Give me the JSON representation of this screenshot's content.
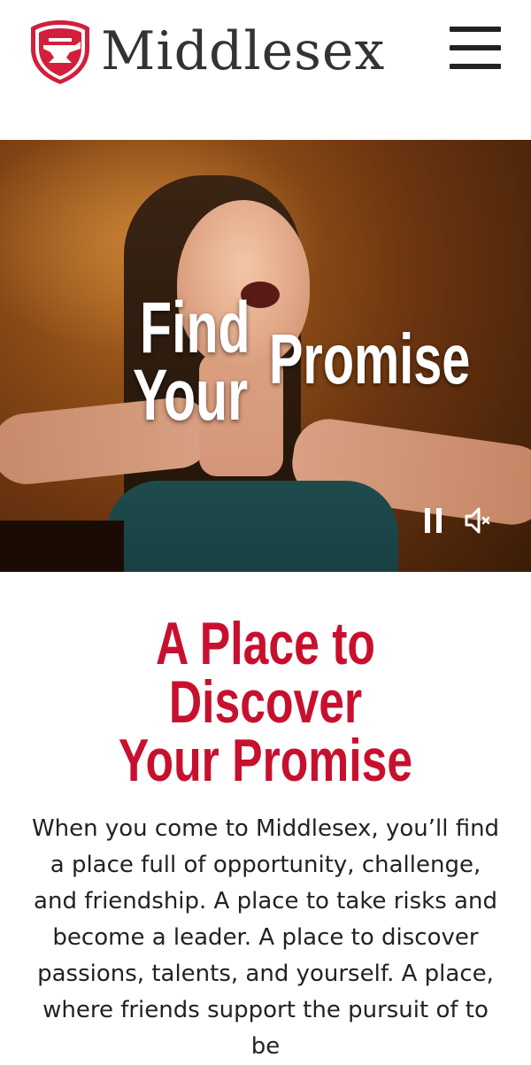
{
  "header": {
    "brand_name": "Middlesex",
    "logo_icon": "shield-anvil-icon",
    "menu_icon": "hamburger-menu-icon",
    "accent_color": "#c8102e"
  },
  "hero": {
    "title_line1": "Find",
    "title_line2": "Your",
    "title_word3": "Promise",
    "pause_icon": "pause-icon",
    "mute_icon": "muted-speaker-icon"
  },
  "intro": {
    "heading_line1": "A Place to Discover",
    "heading_line2": "Your Promise",
    "body": "When you come to Middlesex, you’ll find a place full of opportunity, challenge, and friendship. A place to take risks and become a leader. A place to discover passions, talents, and yourself.  A place, where friends support the pursuit of to be"
  }
}
